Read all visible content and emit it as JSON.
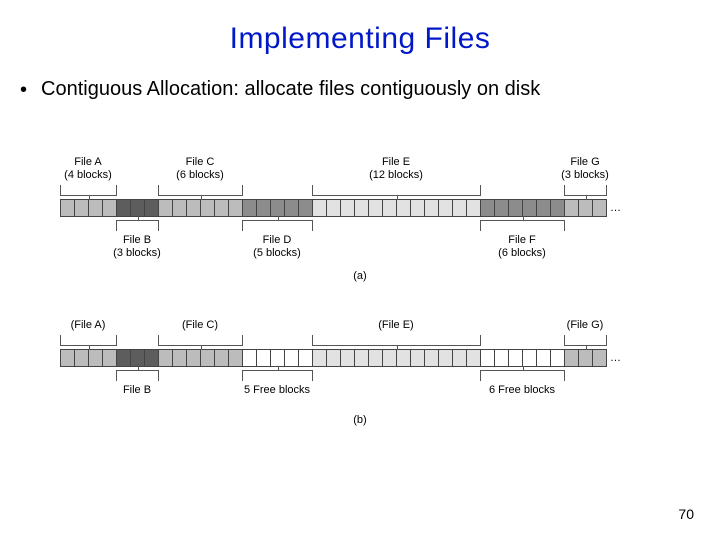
{
  "title": "Implementing Files",
  "bullet": "Contiguous Allocation: allocate files contiguously on disk",
  "page_number": "70",
  "panel_a": {
    "caption": "(a)",
    "strip_dots": "…",
    "top": [
      {
        "name": "File A",
        "sub": "(4 blocks)",
        "start": 0,
        "span": 4
      },
      {
        "name": "File C",
        "sub": "(6 blocks)",
        "start": 7,
        "span": 6
      },
      {
        "name": "File E",
        "sub": "(12 blocks)",
        "start": 18,
        "span": 12
      },
      {
        "name": "File G",
        "sub": "(3 blocks)",
        "start": 36,
        "span": 3
      }
    ],
    "bottom": [
      {
        "name": "File B",
        "sub": "(3 blocks)",
        "start": 4,
        "span": 3
      },
      {
        "name": "File D",
        "sub": "(5 blocks)",
        "start": 13,
        "span": 5
      },
      {
        "name": "File F",
        "sub": "(6 blocks)",
        "start": 30,
        "span": 6
      }
    ],
    "cells": [
      "g1",
      "g1",
      "g1",
      "g1",
      "g3",
      "g3",
      "g3",
      "g1",
      "g1",
      "g1",
      "g1",
      "g1",
      "g1",
      "g2",
      "g2",
      "g2",
      "g2",
      "g2",
      "g0",
      "g0",
      "g0",
      "g0",
      "g0",
      "g0",
      "g0",
      "g0",
      "g0",
      "g0",
      "g0",
      "g0",
      "g2",
      "g2",
      "g2",
      "g2",
      "g2",
      "g2",
      "g1",
      "g1",
      "g1"
    ]
  },
  "panel_b": {
    "caption": "(b)",
    "strip_dots": "…",
    "top": [
      {
        "name": "(File A)",
        "sub": "",
        "start": 0,
        "span": 4
      },
      {
        "name": "(File C)",
        "sub": "",
        "start": 7,
        "span": 6
      },
      {
        "name": "(File E)",
        "sub": "",
        "start": 18,
        "span": 12
      },
      {
        "name": "(File G)",
        "sub": "",
        "start": 36,
        "span": 3
      }
    ],
    "bottom": [
      {
        "name": "File B",
        "sub": "",
        "start": 4,
        "span": 3
      },
      {
        "name": "5 Free blocks",
        "sub": "",
        "start": 13,
        "span": 5
      },
      {
        "name": "6 Free blocks",
        "sub": "",
        "start": 30,
        "span": 6
      }
    ],
    "cells": [
      "g1",
      "g1",
      "g1",
      "g1",
      "g3",
      "g3",
      "g3",
      "g1",
      "g1",
      "g1",
      "g1",
      "g1",
      "g1",
      "free",
      "free",
      "free",
      "free",
      "free",
      "g0",
      "g0",
      "g0",
      "g0",
      "g0",
      "g0",
      "g0",
      "g0",
      "g0",
      "g0",
      "g0",
      "g0",
      "free",
      "free",
      "free",
      "free",
      "free",
      "free",
      "g1",
      "g1",
      "g1"
    ]
  }
}
